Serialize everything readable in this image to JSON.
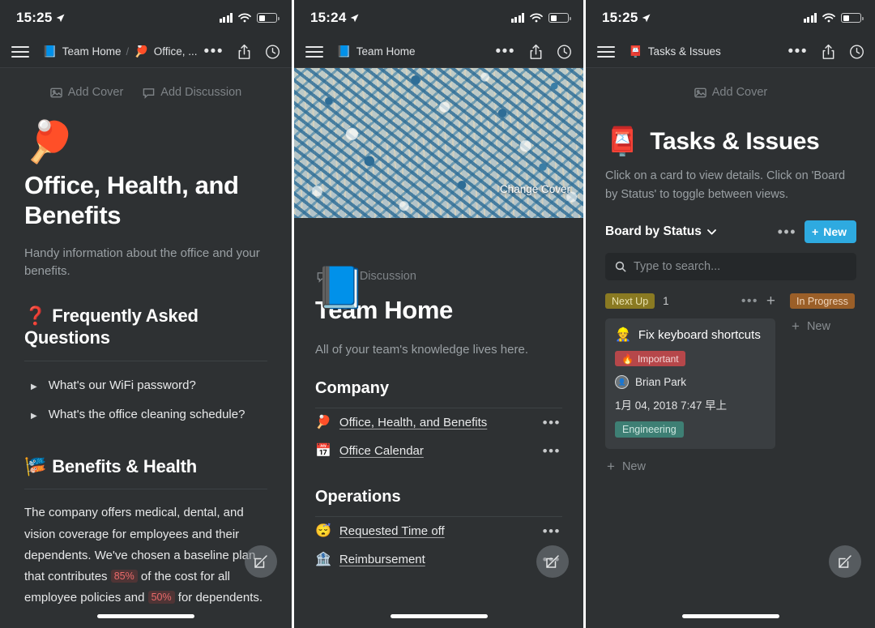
{
  "panels": [
    {
      "status": {
        "time": "15:25",
        "location_arrow": "location-arrow-icon",
        "signal": "signal-bars-icon",
        "wifi": "wifi-icon",
        "battery": "battery-icon"
      },
      "nav": {
        "menu": "hamburger-menu-icon",
        "crumb1_emoji": "📘",
        "crumb1": "Team Home",
        "separator": "/",
        "crumb2_emoji": "🏓",
        "crumb2": "Office, ...",
        "more": "•••",
        "share": "share-icon",
        "history": "history-icon"
      },
      "add_cover": "Add Cover",
      "add_discussion": "Add Discussion",
      "page_emoji": "🏓",
      "title": "Office, Health, and Benefits",
      "subtitle": "Handy information about the office and your benefits.",
      "faq_emoji": "❓",
      "faq_heading": "Frequently Asked Questions",
      "faq_items": [
        "What's our WiFi password?",
        "What's the office cleaning schedule?"
      ],
      "benefits_emoji": "🎏",
      "benefits_heading": "Benefits & Health",
      "benefits_text_1": "The company offers medical, dental, and vision coverage for employees and their dependents. We've chosen a baseline plan that contributes ",
      "benefits_hl_1": "85%",
      "benefits_text_2": " of the cost for all employee policies and ",
      "benefits_hl_2": "50%",
      "benefits_text_3": " for dependents.",
      "fab": "edit-compose-icon"
    },
    {
      "status": {
        "time": "15:24"
      },
      "nav": {
        "crumb1_emoji": "📘",
        "crumb1": "Team Home",
        "more": "•••"
      },
      "change_cover": "Change Cover",
      "page_emoji": "📘",
      "add_discussion": "Add Discussion",
      "title": "Team Home",
      "subtitle": "All of your team's knowledge lives here.",
      "sections": [
        {
          "heading": "Company",
          "links": [
            {
              "emoji": "🏓",
              "label": "Office, Health, and Benefits",
              "more": "•••"
            },
            {
              "emoji": "📅",
              "label": "Office Calendar",
              "more": "•••"
            }
          ]
        },
        {
          "heading": "Operations",
          "links": [
            {
              "emoji": "😴",
              "label": "Requested Time off",
              "more": "•••"
            },
            {
              "emoji": "🏦",
              "label": "Reimbursement",
              "more": "•••"
            }
          ]
        }
      ],
      "fab": "edit-compose-icon"
    },
    {
      "status": {
        "time": "15:25"
      },
      "nav": {
        "crumb1_emoji": "📮",
        "crumb1": "Tasks & Issues",
        "more": "•••"
      },
      "add_cover": "Add Cover",
      "page_emoji": "📮",
      "title": "Tasks & Issues",
      "subtitle": "Click on a card to view details.\nClick on 'Board by Status' to toggle between views.",
      "board_select": "Board by Status",
      "board_more": "•••",
      "new_button": "New",
      "new_button_plus": "+",
      "search_placeholder": "Type to search...",
      "search_value": "",
      "columns": [
        {
          "name": "Next Up",
          "count": "1",
          "color": "#8a7a22",
          "more": "•••",
          "plus": "+",
          "add_new": "New",
          "cards": [
            {
              "emoji": "👷",
              "title": "Fix keyboard shortcuts",
              "priority_emoji": "🔥",
              "priority": "Important",
              "assignee": "Brian Park",
              "date": "1月 04, 2018 7:47 早上",
              "team": "Engineering"
            }
          ]
        },
        {
          "name": "In Progress",
          "color": "#9b5f28",
          "add_new": "New",
          "cards": []
        }
      ],
      "fab": "edit-compose-icon"
    }
  ],
  "colors": {
    "app_bg": "#2e3133",
    "bar_bg": "#2b2e30",
    "accent_blue": "#2eaae0",
    "highlight_red": "#ea6a6a",
    "chip_yellow": "#8a7a22",
    "chip_orange": "#9b5f28",
    "tag_red": "#b6474a",
    "tag_green": "#3e7f74"
  }
}
